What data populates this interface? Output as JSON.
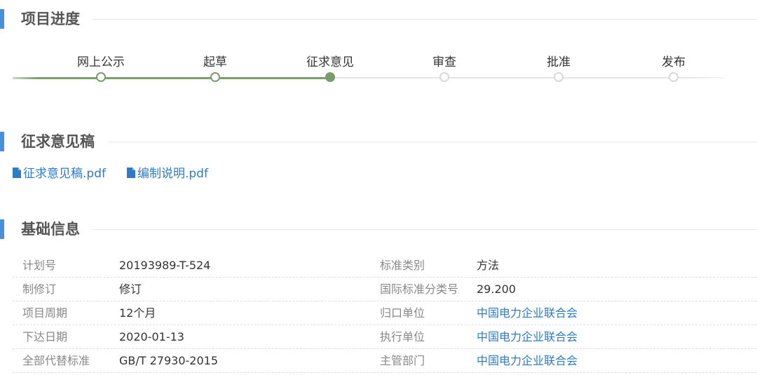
{
  "sections": {
    "progress": "项目进度",
    "draft": "征求意见稿",
    "basic": "基础信息"
  },
  "progress": {
    "steps": [
      {
        "label": "网上公示",
        "state": "done"
      },
      {
        "label": "起草",
        "state": "done"
      },
      {
        "label": "征求意见",
        "state": "current"
      },
      {
        "label": "审查",
        "state": "pending"
      },
      {
        "label": "批准",
        "state": "pending"
      },
      {
        "label": "发布",
        "state": "pending"
      }
    ],
    "completed_steps": 3,
    "total_steps": 6
  },
  "files": [
    {
      "name": "征求意见稿.pdf",
      "icon": "file-icon"
    },
    {
      "name": "编制说明.pdf",
      "icon": "file-icon"
    }
  ],
  "info": {
    "rows": [
      {
        "k1": "计划号",
        "v1": "20193989-T-524",
        "k2": "标准类别",
        "v2": "方法",
        "v2_link": false
      },
      {
        "k1": "制修订",
        "v1": "修订",
        "k2": "国际标准分类号",
        "v2": "29.200",
        "v2_link": false
      },
      {
        "k1": "项目周期",
        "v1": "12个月",
        "k2": "归口单位",
        "v2": "中国电力企业联合会",
        "v2_link": true
      },
      {
        "k1": "下达日期",
        "v1": "2020-01-13",
        "k2": "执行单位",
        "v2": "中国电力企业联合会",
        "v2_link": true
      },
      {
        "k1": "全部代替标准",
        "v1": "GB/T 27930-2015",
        "k2": "主管部门",
        "v2": "中国电力企业联合会",
        "v2_link": true
      }
    ]
  },
  "colors": {
    "accent": "#4a90d9",
    "progress_done": "#7a9c6a",
    "link": "#2e7bc4"
  }
}
